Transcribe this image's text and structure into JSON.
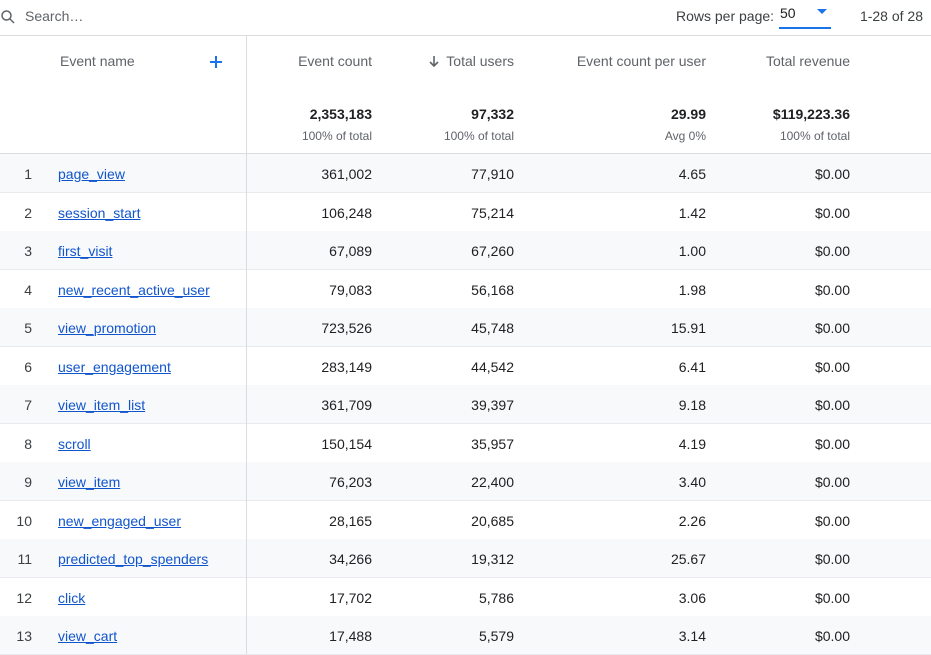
{
  "search": {
    "placeholder": "Search…"
  },
  "pagination": {
    "rows_per_page_label": "Rows per page:",
    "rows_per_page_value": "50",
    "range": "1-28 of 28"
  },
  "columns": {
    "event_name": "Event name",
    "event_count": "Event count",
    "total_users": "Total users",
    "event_count_per_user": "Event count per user",
    "total_revenue": "Total revenue"
  },
  "totals": {
    "event_count": {
      "value": "2,353,183",
      "sub": "100% of total"
    },
    "total_users": {
      "value": "97,332",
      "sub": "100% of total"
    },
    "event_count_per_user": {
      "value": "29.99",
      "sub": "Avg 0%"
    },
    "total_revenue": {
      "value": "$119,223.36",
      "sub": "100% of total"
    }
  },
  "rows": [
    {
      "index": "1",
      "event": "page_view",
      "count": "361,002",
      "users": "77,910",
      "per_user": "4.65",
      "revenue": "$0.00"
    },
    {
      "index": "2",
      "event": "session_start",
      "count": "106,248",
      "users": "75,214",
      "per_user": "1.42",
      "revenue": "$0.00"
    },
    {
      "index": "3",
      "event": "first_visit",
      "count": "67,089",
      "users": "67,260",
      "per_user": "1.00",
      "revenue": "$0.00"
    },
    {
      "index": "4",
      "event": "new_recent_active_user",
      "count": "79,083",
      "users": "56,168",
      "per_user": "1.98",
      "revenue": "$0.00"
    },
    {
      "index": "5",
      "event": "view_promotion",
      "count": "723,526",
      "users": "45,748",
      "per_user": "15.91",
      "revenue": "$0.00"
    },
    {
      "index": "6",
      "event": "user_engagement",
      "count": "283,149",
      "users": "44,542",
      "per_user": "6.41",
      "revenue": "$0.00"
    },
    {
      "index": "7",
      "event": "view_item_list",
      "count": "361,709",
      "users": "39,397",
      "per_user": "9.18",
      "revenue": "$0.00"
    },
    {
      "index": "8",
      "event": "scroll",
      "count": "150,154",
      "users": "35,957",
      "per_user": "4.19",
      "revenue": "$0.00"
    },
    {
      "index": "9",
      "event": "view_item",
      "count": "76,203",
      "users": "22,400",
      "per_user": "3.40",
      "revenue": "$0.00"
    },
    {
      "index": "10",
      "event": "new_engaged_user",
      "count": "28,165",
      "users": "20,685",
      "per_user": "2.26",
      "revenue": "$0.00"
    },
    {
      "index": "11",
      "event": "predicted_top_spenders",
      "count": "34,266",
      "users": "19,312",
      "per_user": "25.67",
      "revenue": "$0.00"
    },
    {
      "index": "12",
      "event": "click",
      "count": "17,702",
      "users": "5,786",
      "per_user": "3.06",
      "revenue": "$0.00"
    },
    {
      "index": "13",
      "event": "view_cart",
      "count": "17,488",
      "users": "5,579",
      "per_user": "3.14",
      "revenue": "$0.00"
    }
  ],
  "colors": {
    "accent": "#1a73e8",
    "link": "#1155cc",
    "row_alt": "#f8f9fa",
    "divider": "#dadce0"
  },
  "icons": {
    "search": "search-icon",
    "add": "plus-icon",
    "sort": "arrow-down-icon",
    "dropdown": "caret-down-icon"
  }
}
